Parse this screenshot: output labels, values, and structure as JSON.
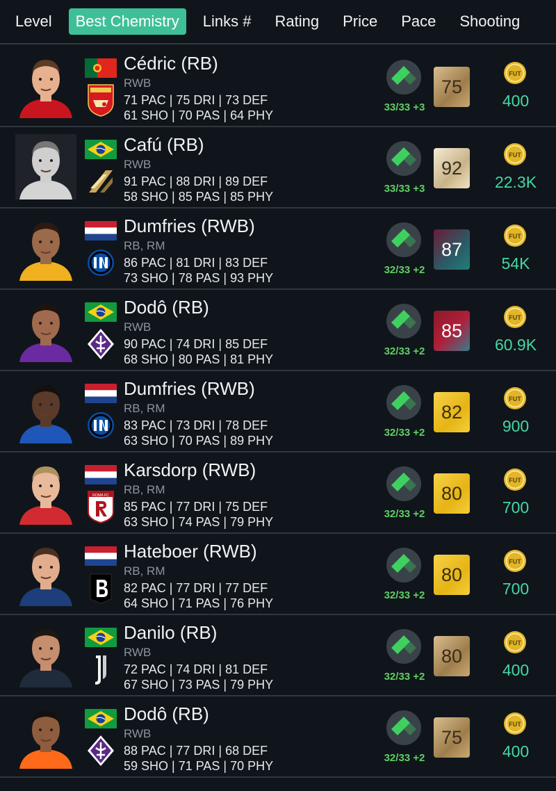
{
  "tabs": [
    "Level",
    "Best Chemistry",
    "Links #",
    "Rating",
    "Price",
    "Pace",
    "Shooting"
  ],
  "active_tab": "Best Chemistry",
  "colors": {
    "accent": "#3fbf98",
    "price": "#45d7a5",
    "chem_label": "#5fcf63",
    "background": "#10151b"
  },
  "players": [
    {
      "name": "Cédric (RB)",
      "positions": "RWB",
      "stats1": "71 PAC | 75 DRI | 73 DEF",
      "stats2": "61 SHO | 70 PAS | 64 PHY",
      "chem": "33/33 +3",
      "rating": "75",
      "rating_style": "bronze",
      "price": "400",
      "flag": "portugal",
      "club": "arsenal-crest",
      "card_icon": "coin-icon"
    },
    {
      "name": "Cafú (RB)",
      "positions": "RWB",
      "stats1": "91 PAC | 88 DRI | 89 DEF",
      "stats2": "58 SHO | 85 PAS | 85 PHY",
      "chem": "33/33 +3",
      "rating": "92",
      "rating_style": "icon",
      "price": "22.3K",
      "flag": "brazil",
      "club": "icons-crest",
      "card_icon": "coin-icon"
    },
    {
      "name": "Dumfries (RWB)",
      "positions": "RB, RM",
      "stats1": "86 PAC | 81 DRI | 83 DEF",
      "stats2": "73 SHO | 78 PAS | 93 PHY",
      "chem": "32/33 +2",
      "rating": "87",
      "rating_style": "special-teal",
      "price": "54K",
      "flag": "netherlands",
      "club": "inter-crest",
      "card_icon": "coin-icon"
    },
    {
      "name": "Dodô (RB)",
      "positions": "RWB",
      "stats1": "90 PAC | 74 DRI | 85 DEF",
      "stats2": "68 SHO | 80 PAS | 81 PHY",
      "chem": "32/33 +2",
      "rating": "85",
      "rating_style": "special-red",
      "price": "60.9K",
      "flag": "brazil",
      "club": "fiorentina-crest",
      "card_icon": "coin-icon"
    },
    {
      "name": "Dumfries (RWB)",
      "positions": "RB, RM",
      "stats1": "83 PAC | 73 DRI | 78 DEF",
      "stats2": "63 SHO | 70 PAS | 89 PHY",
      "chem": "32/33 +2",
      "rating": "82",
      "rating_style": "gold",
      "price": "900",
      "flag": "netherlands",
      "club": "inter-crest",
      "card_icon": "coin-icon"
    },
    {
      "name": "Karsdorp (RWB)",
      "positions": "RB, RM",
      "stats1": "85 PAC | 77 DRI | 75 DEF",
      "stats2": "63 SHO | 74 PAS | 79 PHY",
      "chem": "32/33 +2",
      "rating": "80",
      "rating_style": "gold",
      "price": "700",
      "flag": "netherlands",
      "club": "roma-crest",
      "club_text": "ROMA FC",
      "card_icon": "coin-icon"
    },
    {
      "name": "Hateboer (RWB)",
      "positions": "RB, RM",
      "stats1": "82 PAC | 77 DRI | 77 DEF",
      "stats2": "64 SHO | 71 PAS | 76 PHY",
      "chem": "32/33 +2",
      "rating": "80",
      "rating_style": "gold",
      "price": "700",
      "flag": "netherlands",
      "club": "bergamo-crest",
      "card_icon": "coin-icon"
    },
    {
      "name": "Danilo (RB)",
      "positions": "RWB",
      "stats1": "72 PAC | 74 DRI | 81 DEF",
      "stats2": "67 SHO | 73 PAS | 79 PHY",
      "chem": "32/33 +2",
      "rating": "80",
      "rating_style": "bronze",
      "price": "400",
      "flag": "brazil",
      "club": "juventus-crest",
      "card_icon": "coin-icon"
    },
    {
      "name": "Dodô (RB)",
      "positions": "RWB",
      "stats1": "88 PAC | 77 DRI | 68 DEF",
      "stats2": "59 SHO | 71 PAS | 70 PHY",
      "chem": "32/33 +2",
      "rating": "75",
      "rating_style": "bronze",
      "price": "400",
      "flag": "brazil",
      "club": "fiorentina-crest",
      "card_icon": "coin-icon"
    }
  ]
}
